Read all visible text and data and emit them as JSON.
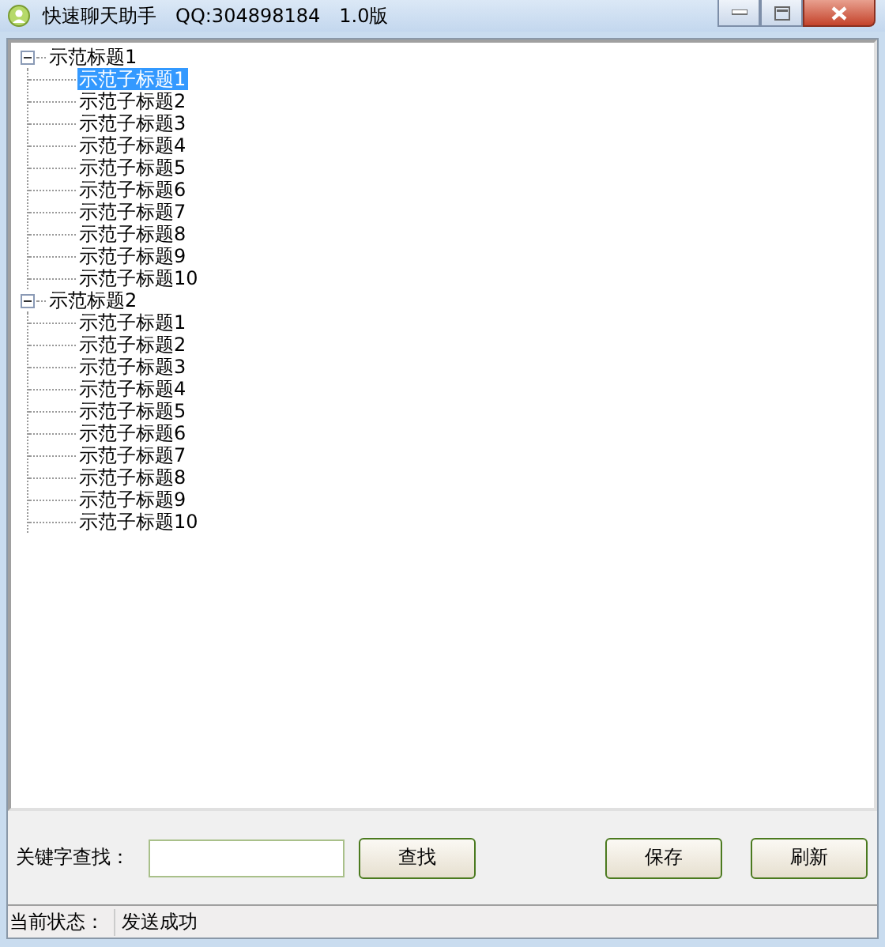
{
  "window": {
    "title": "快速聊天助手　QQ:304898184　1.0版"
  },
  "tree": [
    {
      "label": "示范标题1",
      "expanded": true,
      "selected": false,
      "children": [
        {
          "label": "示范子标题1",
          "selected": true
        },
        {
          "label": "示范子标题2",
          "selected": false
        },
        {
          "label": "示范子标题3",
          "selected": false
        },
        {
          "label": "示范子标题4",
          "selected": false
        },
        {
          "label": "示范子标题5",
          "selected": false
        },
        {
          "label": "示范子标题6",
          "selected": false
        },
        {
          "label": "示范子标题7",
          "selected": false
        },
        {
          "label": "示范子标题8",
          "selected": false
        },
        {
          "label": "示范子标题9",
          "selected": false
        },
        {
          "label": "示范子标题10",
          "selected": false
        }
      ]
    },
    {
      "label": "示范标题2",
      "expanded": true,
      "selected": false,
      "children": [
        {
          "label": "示范子标题1",
          "selected": false
        },
        {
          "label": "示范子标题2",
          "selected": false
        },
        {
          "label": "示范子标题3",
          "selected": false
        },
        {
          "label": "示范子标题4",
          "selected": false
        },
        {
          "label": "示范子标题5",
          "selected": false
        },
        {
          "label": "示范子标题6",
          "selected": false
        },
        {
          "label": "示范子标题7",
          "selected": false
        },
        {
          "label": "示范子标题8",
          "selected": false
        },
        {
          "label": "示范子标题9",
          "selected": false
        },
        {
          "label": "示范子标题10",
          "selected": false
        }
      ]
    }
  ],
  "search": {
    "label": "关键字查找："
  },
  "buttons": {
    "find": "查找",
    "save": "保存",
    "refresh": "刷新"
  },
  "status_bar": {
    "label": "当前状态：",
    "value": "发送成功"
  }
}
